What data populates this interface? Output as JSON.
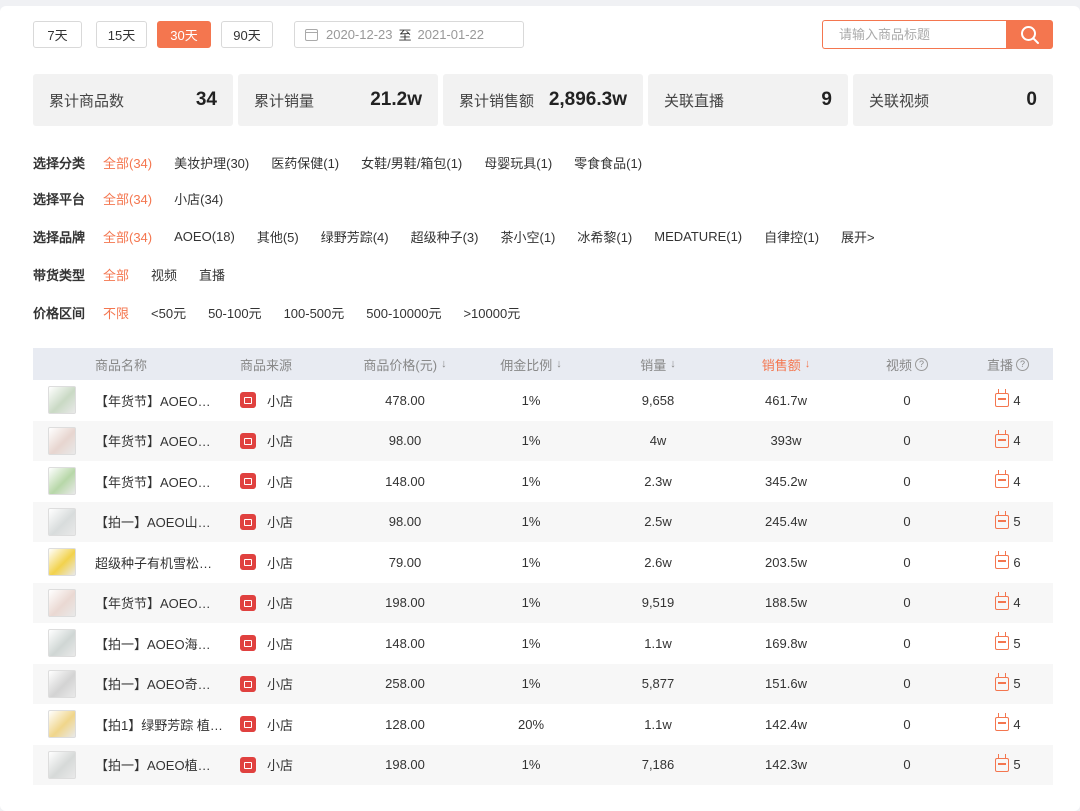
{
  "range_buttons": [
    {
      "label": "7天",
      "active": false
    },
    {
      "label": "15天",
      "active": false
    },
    {
      "label": "30天",
      "active": true
    },
    {
      "label": "90天",
      "active": false
    }
  ],
  "date_range": {
    "start": "2020-12-23",
    "sep": "至",
    "end": "2021-01-22"
  },
  "search": {
    "placeholder": "请输入商品标题"
  },
  "stats": [
    {
      "label": "累计商品数",
      "value": "34"
    },
    {
      "label": "累计销量",
      "value": "21.2w"
    },
    {
      "label": "累计销售额",
      "value": "2,896.3w"
    },
    {
      "label": "关联直播",
      "value": "9"
    },
    {
      "label": "关联视频",
      "value": "0"
    }
  ],
  "filters": {
    "category": {
      "title": "选择分类",
      "options": [
        "全部(34)",
        "美妆护理(30)",
        "医药保健(1)",
        "女鞋/男鞋/箱包(1)",
        "母婴玩具(1)",
        "零食食品(1)"
      ]
    },
    "platform": {
      "title": "选择平台",
      "options": [
        "全部(34)",
        "小店(34)"
      ]
    },
    "brand": {
      "title": "选择品牌",
      "options": [
        "全部(34)",
        "AOEO(18)",
        "其他(5)",
        "绿野芳踪(4)",
        "超级种子(3)",
        "茶小空(1)",
        "冰希黎(1)",
        "MEDATURE(1)",
        "自律控(1)",
        "展开>"
      ]
    },
    "type": {
      "title": "带货类型",
      "options": [
        "全部",
        "视频",
        "直播"
      ]
    },
    "price": {
      "title": "价格区间",
      "options": [
        "不限",
        "<50元",
        "50-100元",
        "100-500元",
        "500-10000元",
        ">10000元"
      ]
    }
  },
  "table": {
    "headers": {
      "name": "商品名称",
      "source": "商品来源",
      "price": "商品价格(元)",
      "commission": "佣金比例",
      "sales": "销量",
      "revenue": "销售额",
      "video": "视频",
      "live": "直播"
    },
    "sort_arrow": "↓",
    "help_mark": "?",
    "rows": [
      {
        "name": "【年货节】AOEO阿…",
        "source": "小店",
        "price": "478.00",
        "commission": "1%",
        "sales": "9,658",
        "revenue": "461.7w",
        "video": "0",
        "live": "4",
        "thumb_color": "#c9d9c4"
      },
      {
        "name": "【年货节】AOEO山…",
        "source": "小店",
        "price": "98.00",
        "commission": "1%",
        "sales": "4w",
        "revenue": "393w",
        "video": "0",
        "live": "4",
        "thumb_color": "#e7d5cf"
      },
      {
        "name": "【年货节】AOEO海…",
        "source": "小店",
        "price": "148.00",
        "commission": "1%",
        "sales": "2.3w",
        "revenue": "345.2w",
        "video": "0",
        "live": "4",
        "thumb_color": "#b7d7a8"
      },
      {
        "name": "【拍一】AOEO山茶…",
        "source": "小店",
        "price": "98.00",
        "commission": "1%",
        "sales": "2.5w",
        "revenue": "245.4w",
        "video": "0",
        "live": "5",
        "thumb_color": "#d8dcdc"
      },
      {
        "name": "超级种子有机雪松…",
        "source": "小店",
        "price": "79.00",
        "commission": "1%",
        "sales": "2.6w",
        "revenue": "203.5w",
        "video": "0",
        "live": "6",
        "thumb_color": "#f2d24c"
      },
      {
        "name": "【年货节】AOEO植…",
        "source": "小店",
        "price": "198.00",
        "commission": "1%",
        "sales": "9,519",
        "revenue": "188.5w",
        "video": "0",
        "live": "4",
        "thumb_color": "#ead8d2"
      },
      {
        "name": "【拍一】AOEO海葡…",
        "source": "小店",
        "price": "148.00",
        "commission": "1%",
        "sales": "1.1w",
        "revenue": "169.8w",
        "video": "0",
        "live": "5",
        "thumb_color": "#cfd6d4"
      },
      {
        "name": "【拍一】AOEO奇焕…",
        "source": "小店",
        "price": "258.00",
        "commission": "1%",
        "sales": "5,877",
        "revenue": "151.6w",
        "video": "0",
        "live": "5",
        "thumb_color": "#d3d3d3"
      },
      {
        "name": "【拍1】绿野芳踪 植…",
        "source": "小店",
        "price": "128.00",
        "commission": "20%",
        "sales": "1.1w",
        "revenue": "142.4w",
        "video": "0",
        "live": "4",
        "thumb_color": "#f0d58a"
      },
      {
        "name": "【拍一】AOEO植焕…",
        "source": "小店",
        "price": "198.00",
        "commission": "1%",
        "sales": "7,186",
        "revenue": "142.3w",
        "video": "0",
        "live": "5",
        "thumb_color": "#d6d9d8"
      }
    ]
  },
  "colors": {
    "accent": "#f4764f",
    "shop": "#e0413f"
  }
}
